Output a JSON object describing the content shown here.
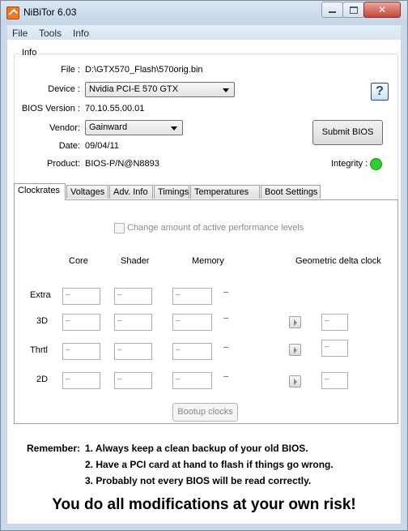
{
  "app": {
    "title": "NiBiTor 6.03",
    "icon": "nibitor-app-icon",
    "close_glyph": "✕"
  },
  "menu": [
    "File",
    "Tools",
    "Info"
  ],
  "info": {
    "legend": "Info",
    "file_label": "File :",
    "file_value": "D:\\GTX570_Flash\\570orig.bin",
    "device_label": "Device :",
    "device_value": "Nvidia PCI-E 570 GTX",
    "bios_version_label": "BIOS Version :",
    "bios_version_value": "70.10.55.00.01",
    "vendor_label": "Vendor:",
    "vendor_value": "Gainward",
    "date_label": "Date:",
    "date_value": "09/04/11",
    "product_label": "Product:",
    "product_value": "BIOS-P/N@N8893",
    "help_glyph": "?",
    "submit_label": "Submit BIOS",
    "integrity_label": "Integrity :",
    "integrity_color": "#2dd12d"
  },
  "tabs": [
    "Clockrates",
    "Voltages",
    "Adv. Info",
    "Timings",
    "Temperatures",
    "Boot Settings"
  ],
  "clockrates": {
    "perf_levels_label": "Change amount of active performance levels",
    "col_core": "Core",
    "col_shader": "Shader",
    "col_memory": "Memory",
    "col_geo": "Geometric delta clock",
    "rows": [
      {
        "label": "Extra",
        "core": "--",
        "shader": "--",
        "memory": "--",
        "suffix": "--"
      },
      {
        "label": "3D",
        "core": "--",
        "shader": "--",
        "memory": "--",
        "suffix": "--",
        "geo": "--"
      },
      {
        "label": "Thrtl",
        "core": "--",
        "shader": "--",
        "memory": "--",
        "suffix": "--",
        "geo": "--"
      },
      {
        "label": "2D",
        "core": "--",
        "shader": "--",
        "memory": "--",
        "suffix": "--",
        "geo": "--"
      }
    ],
    "bootup_label": "Bootup clocks"
  },
  "footer": {
    "remember": "Remember:",
    "note1": "1. Always keep a clean backup of your old BIOS.",
    "note2": "2. Have a PCI card at hand to flash if things go wrong.",
    "note3": "3. Probably not every BIOS will be read correctly.",
    "risk": "You do all modifications at your own risk!"
  }
}
